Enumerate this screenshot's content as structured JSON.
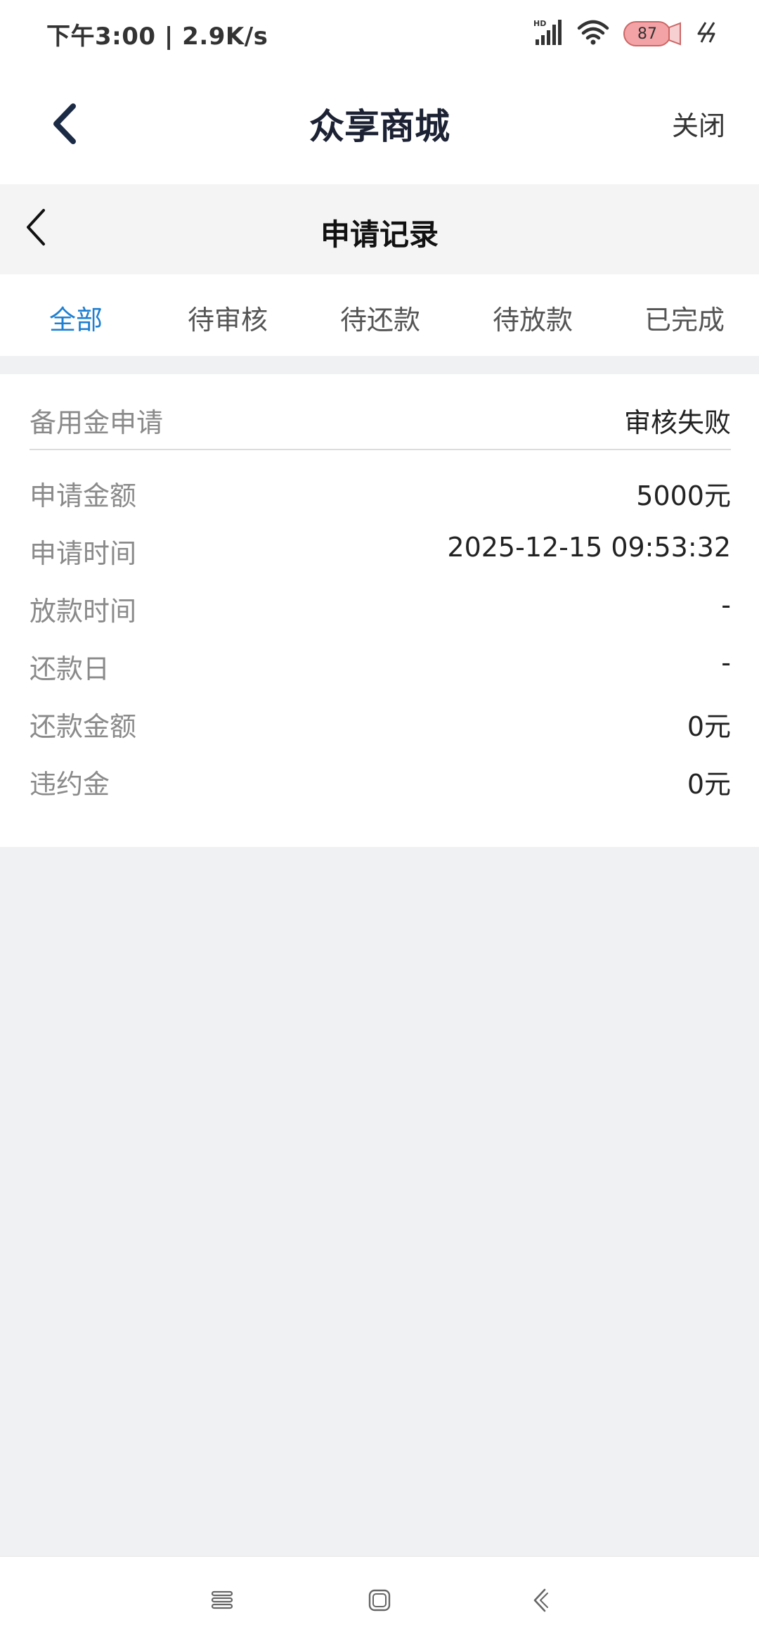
{
  "status_bar": {
    "time": "下午3:00 | 2.9K/s",
    "battery_level": "87",
    "icons": [
      "hd-signal-icon",
      "wifi-icon",
      "battery-icon",
      "charging-icon"
    ]
  },
  "app_header": {
    "title": "众享商城",
    "close_label": "关闭"
  },
  "sub_header": {
    "title": "申请记录"
  },
  "tabs": [
    {
      "label": "全部",
      "active": true
    },
    {
      "label": "待审核",
      "active": false
    },
    {
      "label": "待还款",
      "active": false
    },
    {
      "label": "待放款",
      "active": false
    },
    {
      "label": "已完成",
      "active": false
    }
  ],
  "record": {
    "type": "备用金申请",
    "status": "审核失败",
    "rows": [
      {
        "label": "申请金额",
        "value": "5000元"
      },
      {
        "label": "申请时间",
        "value": "2025-12-15 09:53:32"
      },
      {
        "label": "放款时间",
        "value": "-"
      },
      {
        "label": "还款日",
        "value": "-"
      },
      {
        "label": "还款金额",
        "value": "0元"
      },
      {
        "label": "违约金",
        "value": "0元"
      }
    ]
  },
  "colors": {
    "accent": "#1f7fd1",
    "background": "#f0f1f3",
    "title": "#1c2233"
  }
}
